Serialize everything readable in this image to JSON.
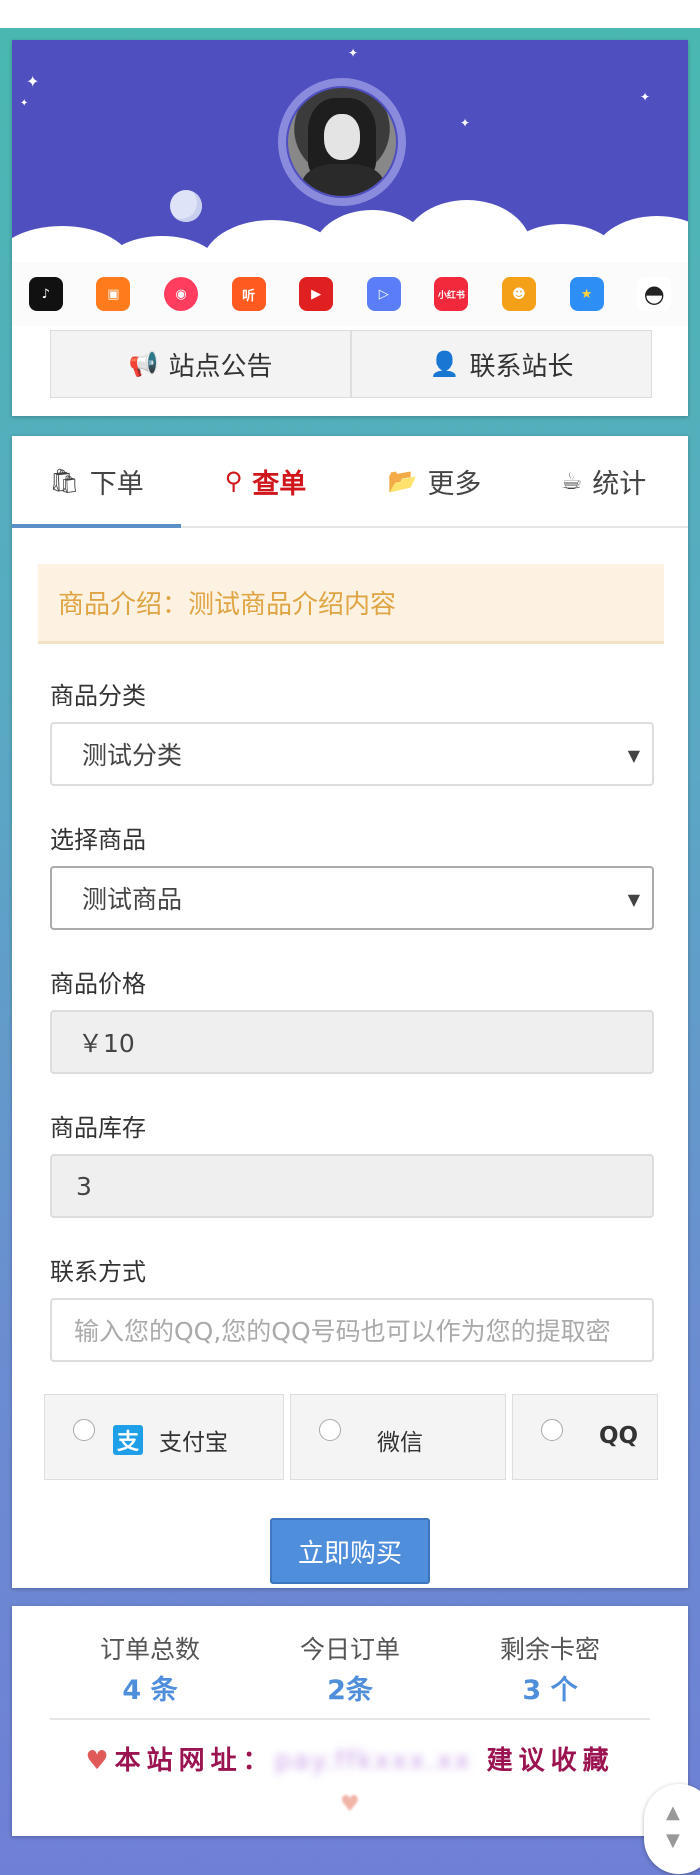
{
  "header": {
    "apps": [
      {
        "icon": "douyin-icon",
        "color": "#111111",
        "glyph": "♪"
      },
      {
        "icon": "kuaishou-icon",
        "color": "#ff7b1c",
        "glyph": "▣"
      },
      {
        "icon": "quanmin-icon",
        "color": "#ff3d5f",
        "glyph": "◉"
      },
      {
        "icon": "ting-icon",
        "color": "#ff5a1f",
        "glyph": "听"
      },
      {
        "icon": "video-play-icon",
        "color": "#e02020",
        "glyph": "▶"
      },
      {
        "icon": "tencent-video-icon",
        "color": "#5b7ef8",
        "glyph": "▷"
      },
      {
        "icon": "xiaohongshu-icon",
        "color": "#f2283c",
        "glyph": "小红书"
      },
      {
        "icon": "emoji-app-icon",
        "color": "#f4a018",
        "glyph": "☻"
      },
      {
        "icon": "qzone-icon",
        "color": "#2d8ff5",
        "glyph": "★"
      },
      {
        "icon": "qq-penguin-icon",
        "color": "#222222",
        "glyph": "◓"
      }
    ],
    "buttons": {
      "notice_label": "站点公告",
      "contact_label": "联系站长"
    }
  },
  "tabs": {
    "order": "下单",
    "query": "查单",
    "more": "更多",
    "stats": "统计"
  },
  "notice": "商品介绍：测试商品介绍内容",
  "form": {
    "category_label": "商品分类",
    "category_value": "测试分类",
    "product_label": "选择商品",
    "product_value": "测试商品",
    "price_label": "商品价格",
    "price_value": "￥10",
    "stock_label": "商品库存",
    "stock_value": "3",
    "contact_label": "联系方式",
    "contact_placeholder": "输入您的QQ,您的QQ号码也可以作为您的提取密"
  },
  "payment": {
    "alipay": "支付宝",
    "wechat": "微信",
    "qq": "QQ"
  },
  "buy_label": "立即购买",
  "stats": {
    "total_label": "订单总数",
    "total_value": "4 条",
    "today_label": "今日订单",
    "today_value": "2条",
    "cards_label": "剩余卡密",
    "cards_value": "3 个"
  },
  "site": {
    "prefix": "本站网址：",
    "url": "pay.ffkxxx.xx",
    "suffix": "建议收藏"
  }
}
